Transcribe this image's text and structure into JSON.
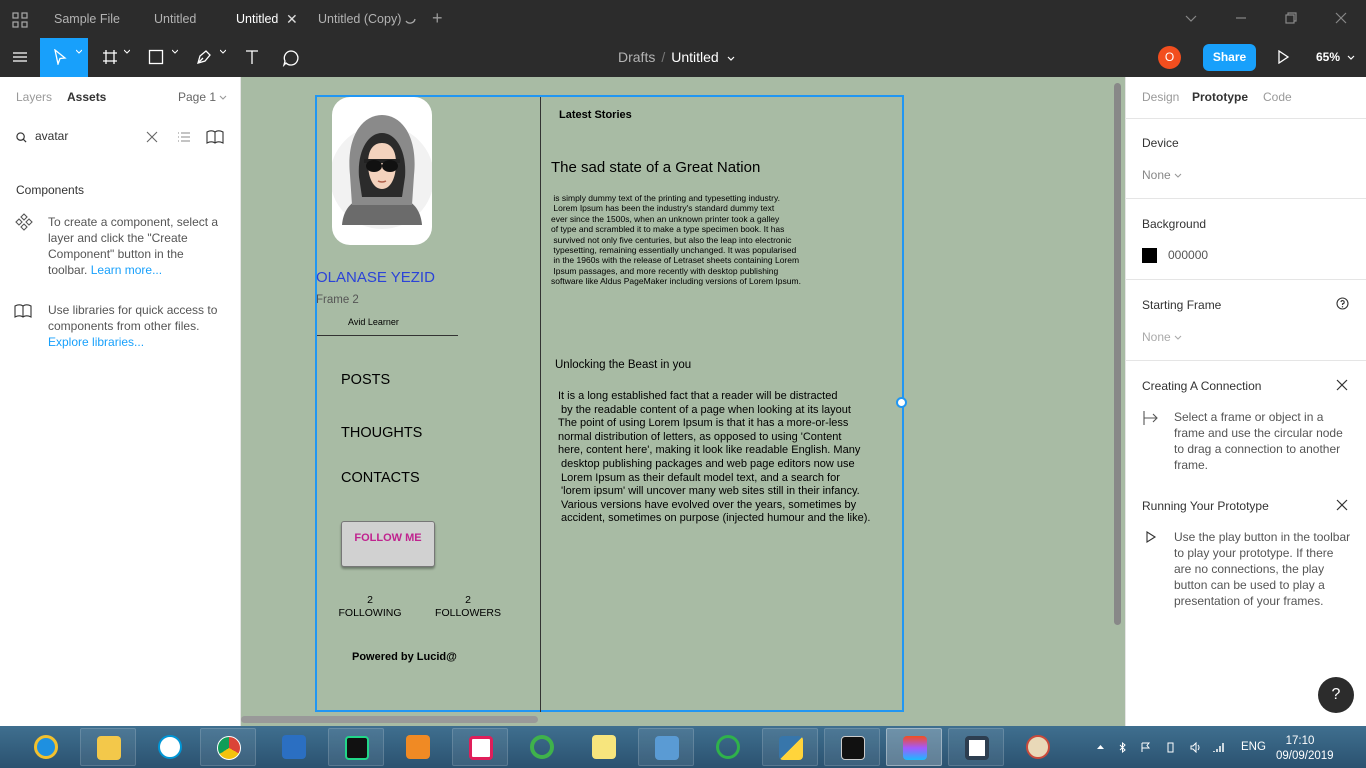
{
  "tabs": [
    {
      "label": "Sample File"
    },
    {
      "label": "Untitled"
    },
    {
      "label": "Untitled"
    },
    {
      "label": "Untitled (Copy)"
    }
  ],
  "toolbar": {
    "breadcrumb_parent": "Drafts",
    "breadcrumb_sep": "/",
    "breadcrumb_file": "Untitled",
    "user_initial": "O",
    "share_label": "Share",
    "zoom": "65%"
  },
  "left_panel": {
    "tab_layers": "Layers",
    "tab_assets": "Assets",
    "page_label": "Page 1",
    "search_value": "avatar",
    "components_heading": "Components",
    "create_component_text": "To create a component, select a layer and click the \"Create Component\" button in the toolbar.",
    "learn_more": "Learn more...",
    "libraries_text": "Use libraries for quick access to components from other files.",
    "explore_libraries": "Explore libraries..."
  },
  "frame": {
    "profile_name": "OLANASE YEZID",
    "frame_label": "Frame 2",
    "role": "Avid Learner",
    "nav": [
      "POSTS",
      "THOUGHTS",
      "CONTACTS"
    ],
    "follow_button": "FOLLOW ME",
    "following_count": "2",
    "following_label": "FOLLOWING",
    "followers_count": "2",
    "followers_label": "FOLLOWERS",
    "powered_by": "Powered by Lucid@",
    "latest_stories": "Latest Stories",
    "story1_title": "The sad state of a Great Nation",
    "story1_body": " is simply dummy text of the printing and typesetting industry.\n Lorem Ipsum has been the industry's standard dummy text\never since the 1500s, when an unknown printer took a galley\nof type and scrambled it to make a type specimen book. It has\n survived not only five centuries, but also the leap into electronic\n typesetting, remaining essentially unchanged. It was popularised\n in the 1960s with the release of Letraset sheets containing Lorem\n Ipsum passages, and more recently with desktop publishing\nsoftware like Aldus PageMaker including versions of Lorem Ipsum.",
    "story2_title": "Unlocking the Beast in you",
    "story2_body": "It is a long established fact that a reader will be distracted\n by the readable content of a page when looking at its layout\nThe point of using Lorem Ipsum is that it has a more-or-less\nnormal distribution of letters, as opposed to using 'Content\nhere, content here', making it look like readable English. Many\n desktop publishing packages and web page editors now use\n Lorem Ipsum as their default model text, and a search for\n 'lorem ipsum' will uncover many web sites still in their infancy.\n Various versions have evolved over the years, sometimes by\n accident, sometimes on purpose (injected humour and the like)."
  },
  "right_panel": {
    "tab_design": "Design",
    "tab_prototype": "Prototype",
    "tab_code": "Code",
    "device_label": "Device",
    "device_value": "None",
    "background_label": "Background",
    "background_hex": "000000",
    "starting_frame_label": "Starting Frame",
    "starting_frame_value": "None",
    "connection_heading": "Creating A Connection",
    "connection_text": "Select a frame or object in a frame and use the circular node to drag a connection to another frame.",
    "prototype_heading": "Running Your Prototype",
    "prototype_text": "Use the play button in the toolbar to play your prototype. If there are no connections, the play button can be used to play a presentation of your frames.",
    "help": "?"
  },
  "taskbar": {
    "apps": [
      "internet-explorer",
      "file-explorer",
      "hp",
      "chrome",
      "visual-studio",
      "pycharm",
      "media-player",
      "slack",
      "spinner-app",
      "sticky-notes",
      "control-panel",
      "green-ring-app",
      "python",
      "terminal",
      "figma",
      "drawer-app",
      "paint"
    ],
    "language": "ENG",
    "time": "17:10",
    "date": "09/09/2019"
  },
  "colors": {
    "accent": "#18a0fb",
    "canvas_bg": "#a8bba4",
    "profile_name": "#2b43d8",
    "follow_text": "#c0238f",
    "user_avatar": "#f24e1e"
  }
}
